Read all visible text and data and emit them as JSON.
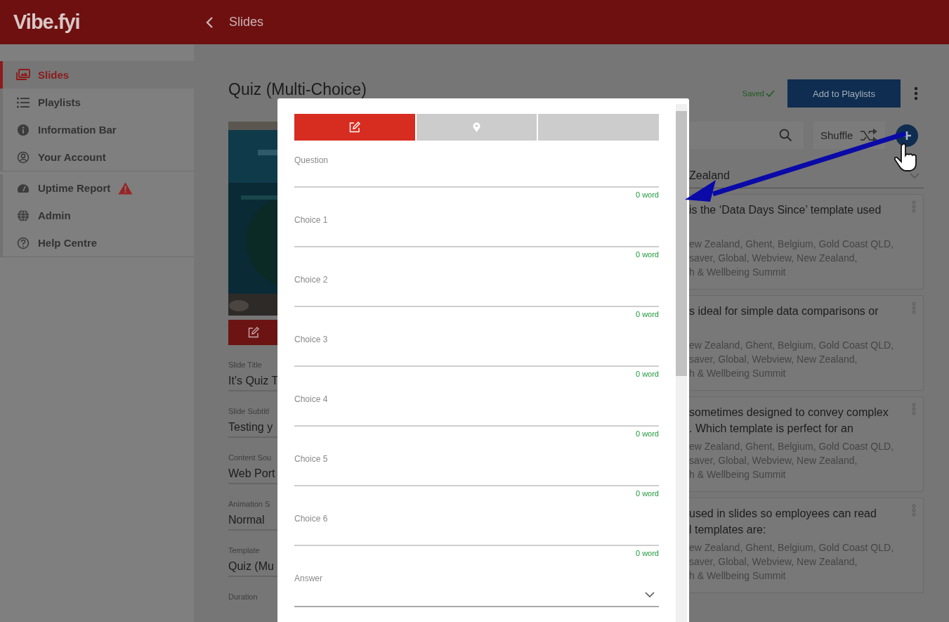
{
  "header": {
    "logo": "Vibe.fyi",
    "title": "Slides"
  },
  "sidebar": {
    "groups": [
      [
        {
          "label": "Slides",
          "selected": true,
          "warning": false
        },
        {
          "label": "Playlists",
          "selected": false,
          "warning": false
        },
        {
          "label": "Information Bar",
          "selected": false,
          "warning": false
        },
        {
          "label": "Your Account",
          "selected": false,
          "warning": false
        }
      ],
      [
        {
          "label": "Uptime Report",
          "selected": false,
          "warning": true
        },
        {
          "label": "Admin",
          "selected": false,
          "warning": false
        },
        {
          "label": "Help Centre",
          "selected": false,
          "warning": false
        }
      ]
    ]
  },
  "page": {
    "title": "Quiz (Multi-Choice)",
    "save_status": "Saved",
    "add_button": "Add to Playlists"
  },
  "slide_fields": [
    {
      "label": "Slide Title",
      "value": "It's Quiz T"
    },
    {
      "label": "Slide Subtitl",
      "value": "Testing y"
    },
    {
      "label": "Content Sou",
      "value": "Web Port"
    },
    {
      "label": "Animation S",
      "value": "Normal"
    },
    {
      "label": "Template",
      "value": "Quiz (Mu"
    },
    {
      "label": "Duration"
    }
  ],
  "shuffle": "Shuffle",
  "location": "Zealand",
  "cards": [
    {
      "question_lines": [
        "is the ‘Data Days Since’ template used"
      ],
      "tag_lines": [
        "ew Zealand, Ghent, Belgium, Gold Coast QLD,",
        "saver, Global, Webview, New Zealand,",
        "h & Wellbeing Summit"
      ]
    },
    {
      "question_lines": [
        "s ideal for simple data comparisons or"
      ],
      "tag_lines": [
        "ew Zealand, Ghent, Belgium, Gold Coast QLD,",
        "saver, Global, Webview, New Zealand,",
        "h & Wellbeing Summit"
      ]
    },
    {
      "question_lines": [
        "sometimes designed to convey complex",
        ". Which template is perfect for an"
      ],
      "tag_lines": [
        "ew Zealand, Ghent, Belgium, Gold Coast QLD,",
        "saver, Global, Webview, New Zealand,",
        "h & Wellbeing Summit"
      ]
    },
    {
      "question_lines": [
        "used in slides so employees can read",
        "l templates are:"
      ],
      "tag_lines": [
        "ew Zealand, Ghent, Belgium, Gold Coast QLD,",
        "saver, Global, Webview, New Zealand,",
        "h & Wellbeing Summit"
      ]
    }
  ],
  "modal": {
    "tabs": [
      {
        "kind": "edit",
        "selected": true
      },
      {
        "kind": "location",
        "selected": false
      },
      {
        "kind": "blank",
        "selected": false
      }
    ],
    "fields": [
      {
        "label": "Question",
        "counter": "0 word"
      },
      {
        "label": "Choice 1",
        "counter": "0 word"
      },
      {
        "label": "Choice 2",
        "counter": "0 word"
      },
      {
        "label": "Choice 3",
        "counter": "0 word"
      },
      {
        "label": "Choice 4",
        "counter": "0 word"
      },
      {
        "label": "Choice 5",
        "counter": "0 word"
      },
      {
        "label": "Choice 6",
        "counter": "0 word"
      }
    ],
    "answer": {
      "label": "Answer"
    }
  }
}
